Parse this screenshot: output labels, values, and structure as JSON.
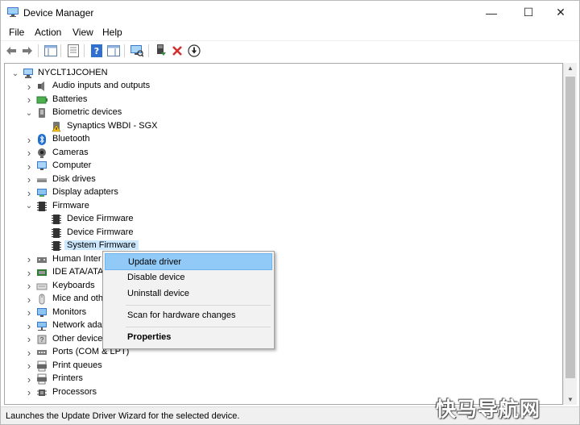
{
  "window": {
    "title": "Device Manager",
    "controls": {
      "minimize": "—",
      "maximize": "☐",
      "close": "✕"
    }
  },
  "menu": [
    "File",
    "Action",
    "View",
    "Help"
  ],
  "toolbar": {
    "buttons": [
      "back-icon",
      "forward-icon",
      "properties-icon",
      "help-icon",
      "scan-icon",
      "monitor-icon",
      "enable-device-icon",
      "uninstall-icon",
      "update-driver-icon"
    ],
    "colors": {
      "uninstall": "#d32f2f",
      "enable": "#2e8b3a",
      "help": "#2f6fd0"
    }
  },
  "tree": {
    "root": "NYCLT1JCOHEN",
    "items": [
      {
        "label": "Audio inputs and outputs",
        "icon": "speaker-icon",
        "expanded": false
      },
      {
        "label": "Batteries",
        "icon": "battery-icon",
        "expanded": false
      },
      {
        "label": "Biometric devices",
        "icon": "biometric-icon",
        "expanded": true
      },
      {
        "label": "Synaptics WBDI - SGX",
        "icon": "warning-device-icon",
        "child": true
      },
      {
        "label": "Bluetooth",
        "icon": "bluetooth-icon",
        "expanded": false
      },
      {
        "label": "Cameras",
        "icon": "camera-icon",
        "expanded": false
      },
      {
        "label": "Computer",
        "icon": "computer-icon",
        "expanded": false
      },
      {
        "label": "Disk drives",
        "icon": "disk-icon",
        "expanded": false
      },
      {
        "label": "Display adapters",
        "icon": "display-icon",
        "expanded": false
      },
      {
        "label": "Firmware",
        "icon": "firmware-icon",
        "expanded": true
      },
      {
        "label": "Device Firmware",
        "icon": "firmware-icon",
        "child": true
      },
      {
        "label": "Device Firmware",
        "icon": "firmware-icon",
        "child": true
      },
      {
        "label": "System Firmware",
        "icon": "firmware-icon",
        "child": true,
        "selected": true
      },
      {
        "label": "Human Inter",
        "icon": "hid-icon",
        "expanded": false
      },
      {
        "label": "IDE ATA/ATA",
        "icon": "ide-icon",
        "expanded": false
      },
      {
        "label": "Keyboards",
        "icon": "keyboard-icon",
        "expanded": false
      },
      {
        "label": "Mice and oth",
        "icon": "mouse-icon",
        "expanded": false
      },
      {
        "label": "Monitors",
        "icon": "monitor-icon",
        "expanded": false
      },
      {
        "label": "Network ada",
        "icon": "network-icon",
        "expanded": false
      },
      {
        "label": "Other device",
        "icon": "other-device-icon",
        "expanded": false
      },
      {
        "label": "Ports (COM & LPT)",
        "icon": "port-icon",
        "expanded": false
      },
      {
        "label": "Print queues",
        "icon": "print-queue-icon",
        "expanded": false
      },
      {
        "label": "Printers",
        "icon": "printer-icon",
        "expanded": false
      },
      {
        "label": "Processors",
        "icon": "processor-icon",
        "expanded": false
      }
    ]
  },
  "context_menu": {
    "items": [
      {
        "label": "Update driver",
        "highlighted": true
      },
      {
        "label": "Disable device"
      },
      {
        "label": "Uninstall device"
      },
      {
        "label": "Scan for hardware changes"
      },
      {
        "label": "Properties",
        "bold": true
      }
    ]
  },
  "status": {
    "text": "Launches the Update Driver Wizard for the selected device."
  },
  "watermark": {
    "text": "快马导航网"
  }
}
